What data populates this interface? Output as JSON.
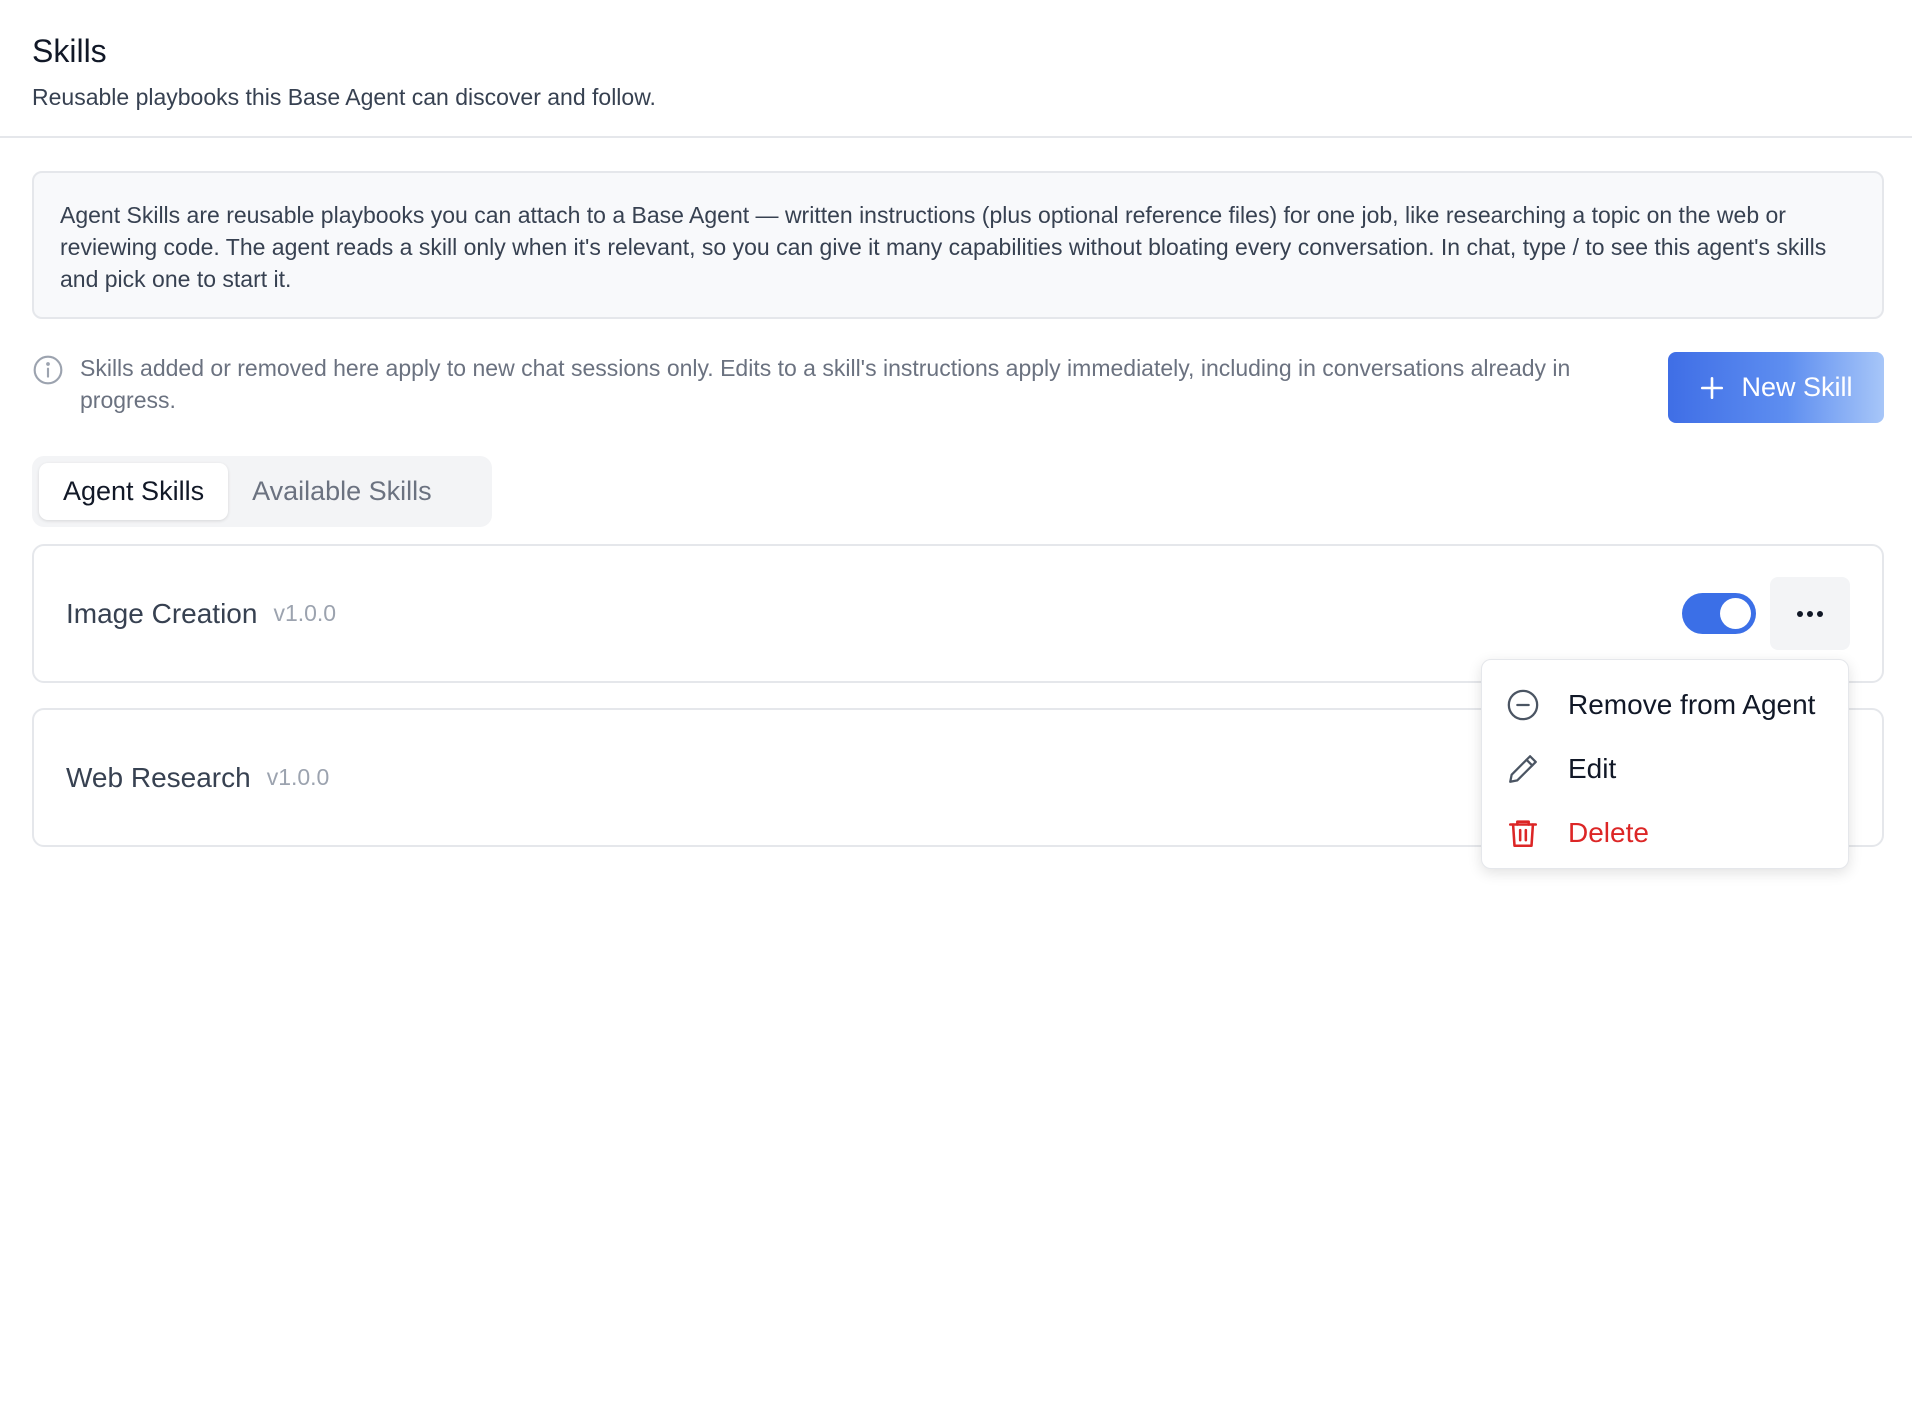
{
  "header": {
    "title": "Skills",
    "subtitle": "Reusable playbooks this Base Agent can discover and follow."
  },
  "intro": "Agent Skills are reusable playbooks you can attach to a Base Agent — written instructions (plus optional reference files) for one job, like researching a topic on the web or reviewing code. The agent reads a skill only when it's relevant, so you can give it many capabilities without bloating every conversation. In chat, type / to see this agent's skills and pick one to start it.",
  "notice": "Skills added or removed here apply to new chat sessions only. Edits to a skill's instructions apply immediately, including in conversations already in progress.",
  "actions": {
    "new_skill_label": "New Skill"
  },
  "tabs": [
    {
      "label": "Agent Skills",
      "active": true
    },
    {
      "label": "Available Skills",
      "active": false
    }
  ],
  "skills": [
    {
      "name": "Image Creation",
      "version": "v1.0.0",
      "enabled": true
    },
    {
      "name": "Web Research",
      "version": "v1.0.0"
    }
  ],
  "menu": {
    "items": [
      {
        "label": "Remove from Agent",
        "icon": "minus-circle-icon"
      },
      {
        "label": "Edit",
        "icon": "pencil-icon"
      },
      {
        "label": "Delete",
        "icon": "trash-icon"
      }
    ]
  },
  "colors": {
    "accent": "#3b6fe7",
    "danger": "#dc2626",
    "muted_text": "#6b7280"
  }
}
